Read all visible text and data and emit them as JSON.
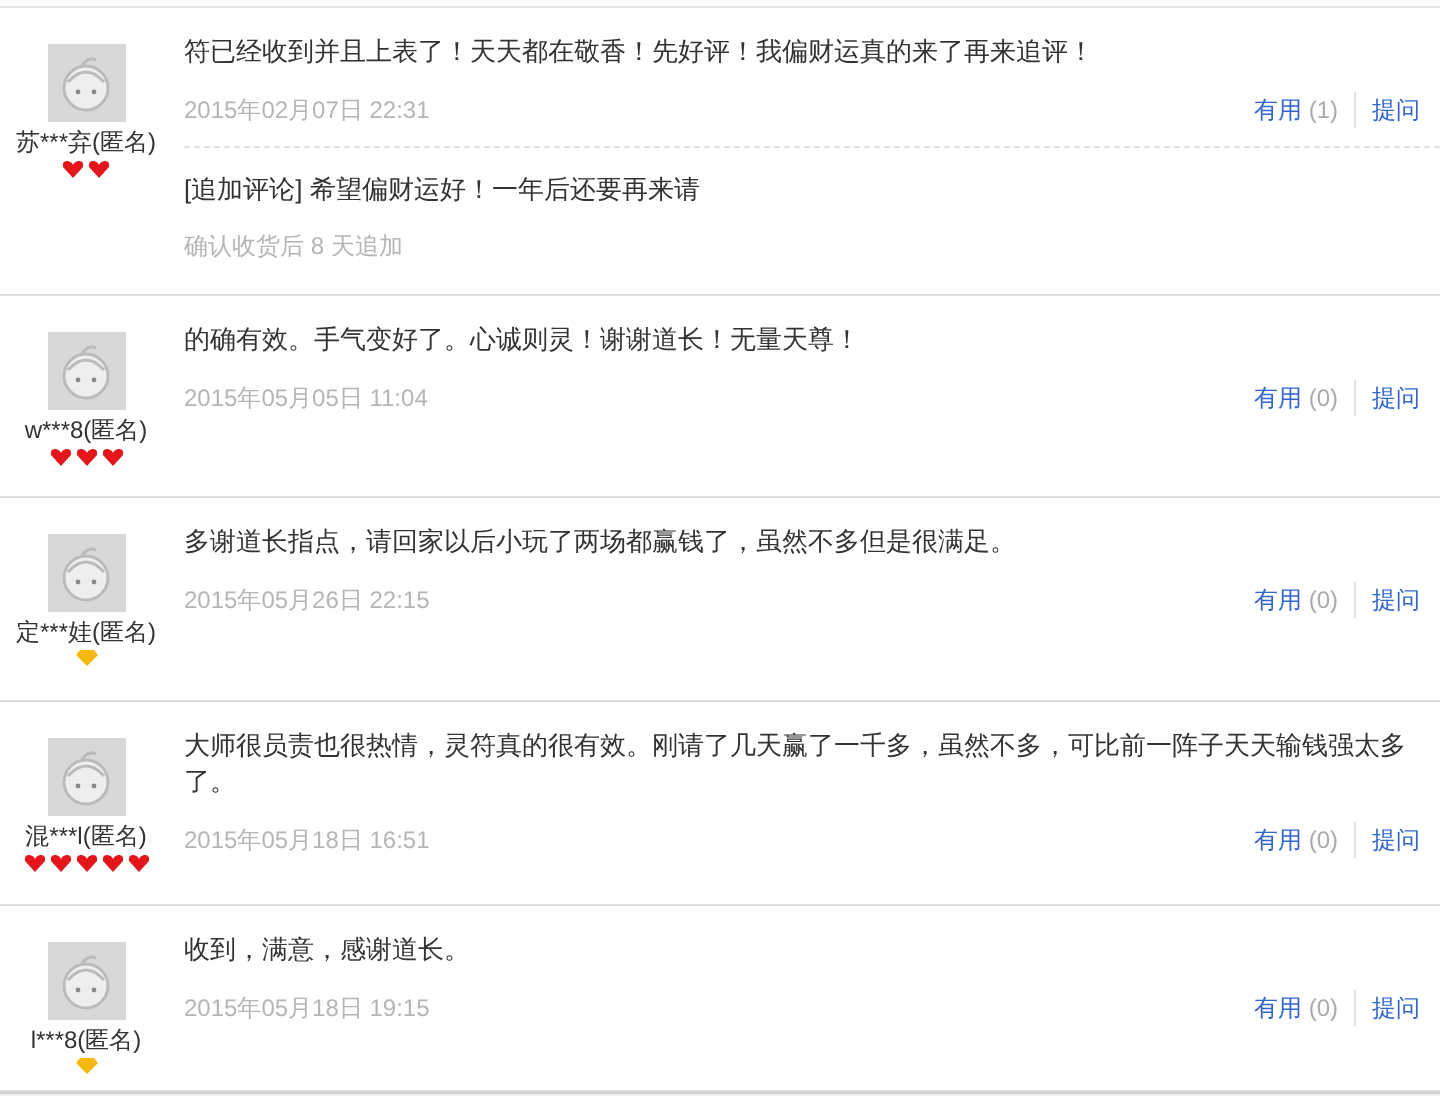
{
  "reviews": [
    {
      "user": "苏***弃(匿名)",
      "rank": [
        {
          "kind": "heart"
        },
        {
          "kind": "heart"
        }
      ],
      "text": "符已经收到并且上表了！天天都在敬香！先好评！我偏财运真的来了再来追评！",
      "date": "2015年02月07日 22:31",
      "useful_label": "有用",
      "useful_count": "(1)",
      "ask": "提问",
      "append": {
        "text": "[追加评论] 希望偏财运好！一年后还要再来请",
        "note": "确认收货后 8 天追加"
      }
    },
    {
      "user": "w***8(匿名)",
      "rank": [
        {
          "kind": "heart"
        },
        {
          "kind": "heart"
        },
        {
          "kind": "heart"
        }
      ],
      "text": "的确有效。手气变好了。心诚则灵！谢谢道长！无量天尊！",
      "date": "2015年05月05日 11:04",
      "useful_label": "有用",
      "useful_count": "(0)",
      "ask": "提问"
    },
    {
      "user": "定***娃(匿名)",
      "rank": [
        {
          "kind": "diamond"
        }
      ],
      "text": "多谢道长指点，请回家以后小玩了两场都赢钱了，虽然不多但是很满足。",
      "date": "2015年05月26日 22:15",
      "useful_label": "有用",
      "useful_count": "(0)",
      "ask": "提问"
    },
    {
      "user": "混***l(匿名)",
      "rank": [
        {
          "kind": "heart"
        },
        {
          "kind": "heart"
        },
        {
          "kind": "heart"
        },
        {
          "kind": "heart"
        },
        {
          "kind": "heart"
        }
      ],
      "text": "大师很员责也很热情，灵符真的很有效。刚请了几天赢了一千多，虽然不多，可比前一阵子天天输钱强太多了。",
      "date": "2015年05月18日 16:51",
      "useful_label": "有用",
      "useful_count": "(0)",
      "ask": "提问"
    },
    {
      "user": "l***8(匿名)",
      "rank": [
        {
          "kind": "diamond"
        }
      ],
      "text": "收到，满意，感谢道长。",
      "date": "2015年05月18日 19:15",
      "useful_label": "有用",
      "useful_count": "(0)",
      "ask": "提问"
    }
  ]
}
